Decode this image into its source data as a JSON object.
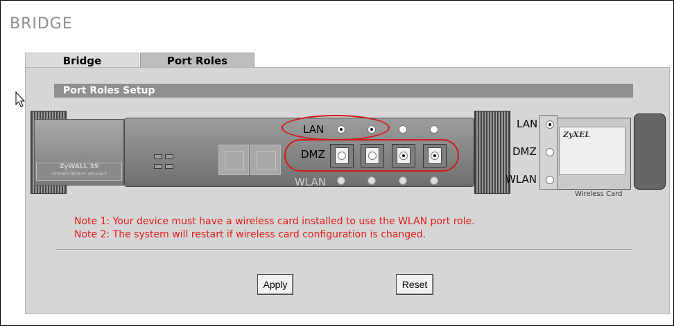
{
  "page": {
    "title": "BRIDGE"
  },
  "tabs": [
    {
      "label": "Bridge",
      "active": false
    },
    {
      "label": "Port Roles",
      "active": true
    }
  ],
  "section": {
    "title": "Port Roles Setup"
  },
  "device": {
    "brand": "ZyWALL 35",
    "brand_sub": "INTERNET SECURITY APPLIANCE",
    "row_labels": {
      "lan": "LAN",
      "dmz": "DMZ",
      "wlan": "WLAN"
    },
    "ports": [
      {
        "lan": true,
        "dmz": false,
        "wlan": false
      },
      {
        "lan": true,
        "dmz": false,
        "wlan": false
      },
      {
        "lan": false,
        "dmz": true,
        "wlan": false
      },
      {
        "lan": false,
        "dmz": true,
        "wlan": false
      }
    ]
  },
  "wireless_card": {
    "labels": {
      "lan": "LAN",
      "dmz": "DMZ",
      "wlan": "WLAN"
    },
    "caption": "Wireless Card",
    "selected": "lan",
    "logo": "ZyXEL"
  },
  "notes": [
    "Note 1: Your device must have a wireless card installed to use the WLAN port role.",
    "Note 2: The system will restart if wireless card configuration is changed."
  ],
  "buttons": {
    "apply": "Apply",
    "reset": "Reset"
  },
  "colors": {
    "highlight": "#d21a1a",
    "note_text": "#e01a1a",
    "section_bar": "#8f8f8f"
  }
}
